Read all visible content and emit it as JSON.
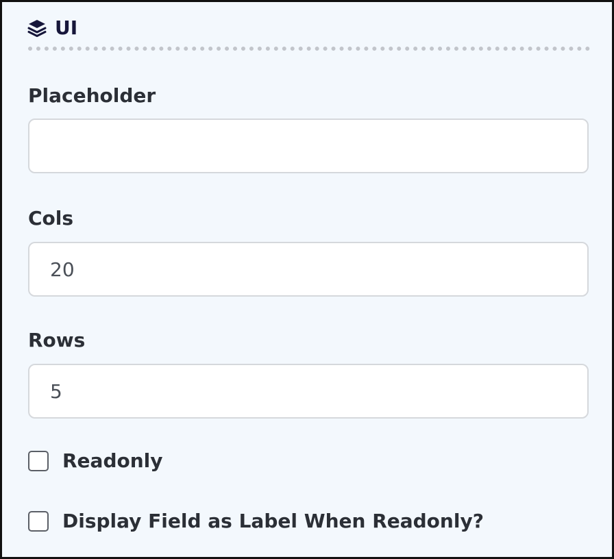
{
  "section": {
    "title": "UI",
    "icon": "layers-icon"
  },
  "fields": {
    "placeholder": {
      "label": "Placeholder",
      "value": ""
    },
    "cols": {
      "label": "Cols",
      "value": "20"
    },
    "rows": {
      "label": "Rows",
      "value": "5"
    }
  },
  "checkboxes": {
    "readonly": {
      "label": "Readonly",
      "checked": false
    },
    "display_as_label": {
      "label": "Display Field as Label When Readonly?",
      "checked": false
    }
  },
  "colors": {
    "panel_background": "#f3f8fd",
    "title_text": "#16163a",
    "label_text": "#2b2f36",
    "input_border": "#d5d8dc"
  }
}
